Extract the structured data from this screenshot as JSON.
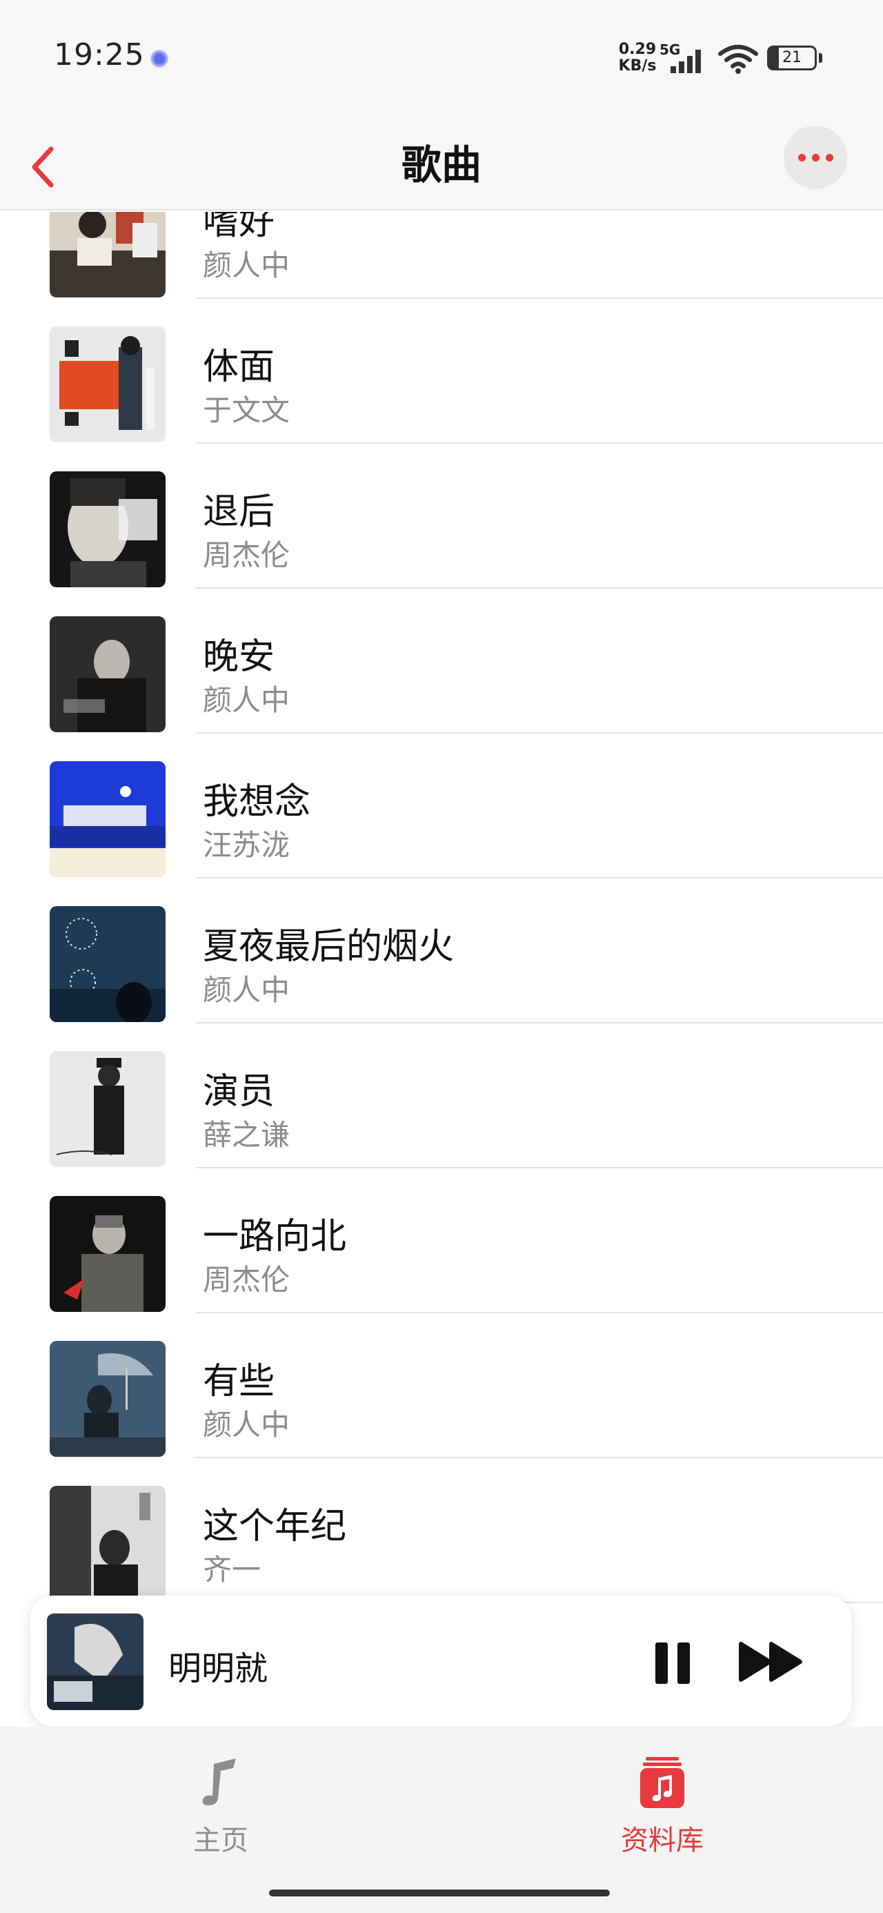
{
  "status_bar": {
    "time": "19:25",
    "net_speed_value": "0.29",
    "net_speed_unit": "KB/s",
    "network_type": "5G",
    "battery_level": "21",
    "icons": [
      "notification-dot-icon",
      "signal-icon",
      "wifi-icon",
      "battery-icon"
    ]
  },
  "header": {
    "title": "歌曲",
    "back_icon": "chevron-left-icon",
    "more_icon": "more-dots-icon"
  },
  "songs": [
    {
      "title": "嗜好",
      "artist": "颜人中"
    },
    {
      "title": "体面",
      "artist": "于文文"
    },
    {
      "title": "退后",
      "artist": "周杰伦"
    },
    {
      "title": "晚安",
      "artist": "颜人中"
    },
    {
      "title": "我想念",
      "artist": "汪苏泷"
    },
    {
      "title": "夏夜最后的烟火",
      "artist": "颜人中"
    },
    {
      "title": "演员",
      "artist": "薛之谦"
    },
    {
      "title": "一路向北",
      "artist": "周杰伦"
    },
    {
      "title": "有些",
      "artist": "颜人中"
    },
    {
      "title": "这个年纪",
      "artist": "齐一"
    }
  ],
  "now_playing": {
    "title": "明明就",
    "controls": [
      "pause-icon",
      "fast-forward-icon"
    ]
  },
  "tabs": [
    {
      "label": "主页",
      "icon": "music-note-icon",
      "active": false
    },
    {
      "label": "资料库",
      "icon": "library-icon",
      "active": true
    }
  ],
  "colors": {
    "accent": "#e8393d",
    "secondary_text": "#8b8b8b",
    "background": "#f7f7f7"
  }
}
